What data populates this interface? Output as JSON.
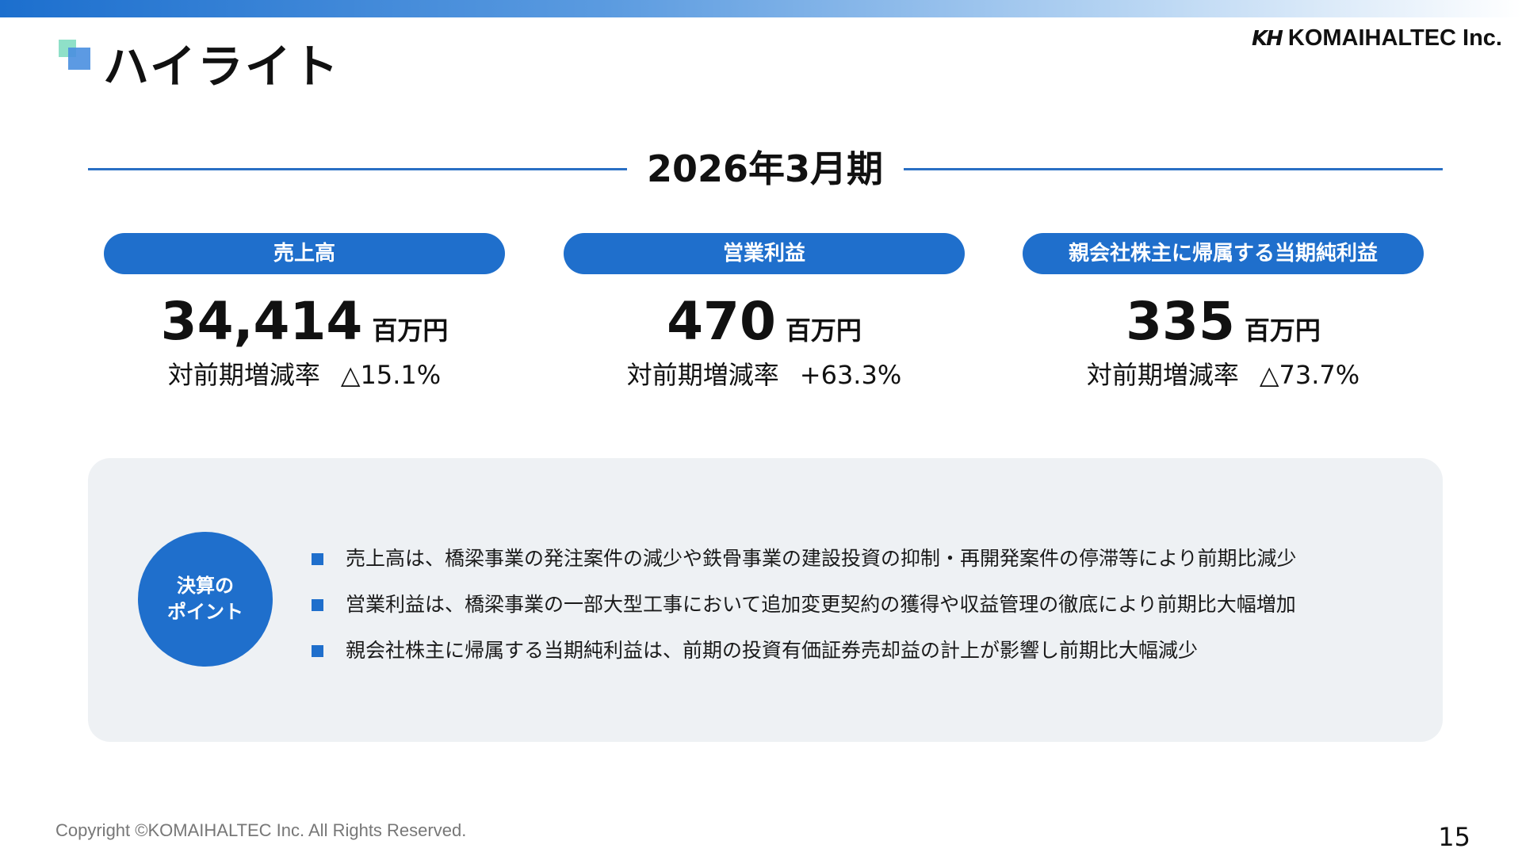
{
  "header": {
    "title": "ハイライト",
    "logo_mark": "KH",
    "logo_text": "KOMAIHALTEC Inc.",
    "icon": "square-mark-icon"
  },
  "period": "2026年3月期",
  "metrics": [
    {
      "label": "売上高",
      "value": "34,414",
      "unit": "百万円",
      "change_label": "対前期増減率",
      "change_value": "△15.1%"
    },
    {
      "label": "営業利益",
      "value": "470",
      "unit": "百万円",
      "change_label": "対前期増減率",
      "change_value": "+63.3%"
    },
    {
      "label": "親会社株主に帰属する当期純利益",
      "value": "335",
      "unit": "百万円",
      "change_label": "対前期増減率",
      "change_value": "△73.7%"
    }
  ],
  "points": {
    "badge_line1": "決算の",
    "badge_line2": "ポイント",
    "items": [
      "売上高は、橋梁事業の発注案件の減少や鉄骨事業の建設投資の抑制・再開発案件の停滞等により前期比減少",
      "営業利益は、橋梁事業の一部大型工事において追加変更契約の獲得や収益管理の徹底により前期比大幅増加",
      "親会社株主に帰属する当期純利益は、前期の投資有価証券売却益の計上が影響し前期比大幅減少"
    ]
  },
  "footer": {
    "copyright": "Copyright ©KOMAIHALTEC Inc. All Rights Reserved.",
    "page_number": "15"
  },
  "colors": {
    "accent": "#1f6fcc",
    "panel_bg": "#eef1f4",
    "title_mark_light": "#8fe0c8",
    "title_mark_dark": "#4a8fe0"
  }
}
